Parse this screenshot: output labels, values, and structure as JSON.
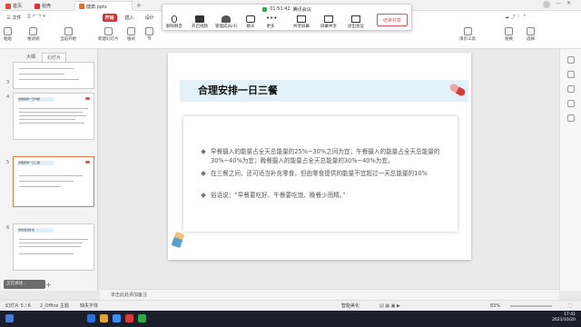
{
  "titlebar": {
    "tabs": [
      {
        "label": "首页"
      },
      {
        "label": "稻壳"
      },
      {
        "label": "健康.pptx"
      }
    ]
  },
  "menubar": {
    "items": [
      "三 文件",
      "开始",
      "插入",
      "设计"
    ],
    "active": "开始"
  },
  "toolbar": {
    "left_items": [
      "粘贴",
      "格式刷",
      "当前开始",
      "新建幻灯片",
      "版式",
      "节"
    ],
    "right_items": [
      "演示工具",
      "替换",
      "选择"
    ]
  },
  "meeting": {
    "time": "01:51:42",
    "title": "腾讯会议",
    "buttons": [
      "解除静音",
      "开启视频",
      "管理成员(4)",
      "聊天",
      "更多",
      "共享屏幕",
      "屏幕共享",
      "退出会议"
    ],
    "share_label": "结束共享"
  },
  "leftpanel": {
    "tabs": [
      "大纲",
      "幻灯片"
    ],
    "active_tab": "幻灯片",
    "thumbs": [
      {
        "num": "3",
        "title": ""
      },
      {
        "num": "4",
        "title": "食物多样一日均衡"
      },
      {
        "num": "5",
        "title": "合理安排一日三餐"
      },
      {
        "num": "6",
        "title": "零食适当补充"
      }
    ],
    "float_label": "正在讲述..."
  },
  "slide": {
    "title": "合理安排一日三餐",
    "bullets": [
      "早餐摄入的能量占全天总能量的25%~30%之间为宜；午餐摄入的能量占全天总能量的30%~40%为宜；晚餐摄入的能量占全天总能量的30%~40%为宜。",
      "在三餐之间，还可适当补充零食，但由零食提供的能量不宜超过一天总能量的10%",
      "俗话说：“早餐要吃好、午餐要吃饱、晚餐少而精。”"
    ]
  },
  "notes": {
    "placeholder": "单击此处添加备注"
  },
  "statusbar": {
    "slide_info": "幻灯片 5 / 6",
    "theme": "2_Office 主题",
    "font_status": "缺失字体",
    "smart_beautify": "智能美化",
    "zoom": "83%"
  },
  "taskbar": {
    "time": "17:41",
    "date": "2021/10/20"
  },
  "colors": {
    "accent": "#d0353f",
    "title_band": "#e2f1f8",
    "selected_thumb": "#e07a3f"
  }
}
